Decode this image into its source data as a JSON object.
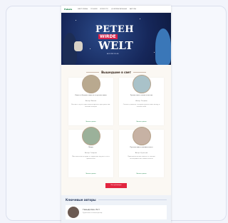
{
  "nav": {
    "logo": "Fabula",
    "links": [
      "ВИКТОРИНЫ",
      "ПОЭЗИЯ",
      "ИЛЛЮСТР.",
      "ДОКУМЕНТАЛЬНЫЕ",
      "АВТОРЫ"
    ]
  },
  "hero": {
    "line1": "РЕТЕН",
    "line2": "WIRDE",
    "line3": "WELT",
    "subtitle": "AUS UND FOLGE"
  },
  "section1": {
    "title": "Вышедшие в свет"
  },
  "cards": [
    {
      "title": "Ключ от бездны: повесть о путешествиях",
      "meta": "Автор: Иванов",
      "desc": "Рассказ о пути героя сквозь время и пространство, полный загадок",
      "more": "Читать далее"
    },
    {
      "title": "Лунная ночь: сказка о мечтах",
      "meta": "Автор: Петрова",
      "desc": "Сказка о девочке, которая искала свою звезду в ночном небе",
      "more": "Читать далее"
    },
    {
      "title": "Оберег",
      "meta": "Автор: Смирнов",
      "desc": "Мистическая история о старинном амулете и его хранителях",
      "more": "Читать далее"
    },
    {
      "title": "Путешествие в неизвестность",
      "meta": "Автор: Кузнецов",
      "desc": "Приключенческая повесть о смелых исследователях новых земель",
      "more": "Читать далее"
    }
  ],
  "all_button": "Все публикации",
  "section2": {
    "title": "Ключевые авторы"
  },
  "artist": {
    "name": "Гвендолин Лот",
    "line": "Художник и иллюстратор"
  }
}
